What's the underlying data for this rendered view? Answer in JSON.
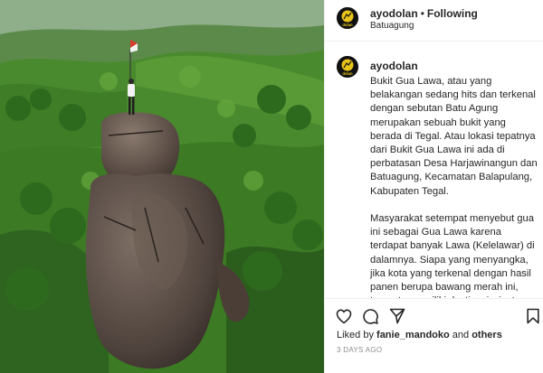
{
  "post": {
    "author": "ayodolan",
    "separator": "•",
    "follow_status": "Following",
    "location": "Batuagung",
    "logo_text": "dolan"
  },
  "caption": {
    "username": "ayodolan",
    "text": "Bukit Gua Lawa, atau yang belakangan sedang hits dan terkenal dengan sebutan Batu Agung merupakan sebuah bukit yang berada di Tegal. Atau lokasi tepatnya dari Bukit Gua Lawa ini ada di perbatasan Desa Harjawinangun dan Batuagung, Kecamatan Balapulang, Kabupaten Tegal.\n\nMasyarakat setempat menyebut gua ini sebagai Gua Lawa karena terdapat banyak Lawa (Kelelawar) di dalamnya. Siapa yang menyangka, jika kota yang terkenal dengan hasil panen berupa bawang merah ini, ternyata memiliki destinasi wisata yang mampu menghilangkan rasa penat yang begitu ampuh. Jadi"
  },
  "actions": {
    "like_icon": "heart-icon",
    "comment_icon": "comment-icon",
    "share_icon": "paper-plane-icon",
    "save_icon": "bookmark-icon"
  },
  "likes": {
    "prefix": "Liked by ",
    "user": "fanie_mandoko",
    "middle": " and ",
    "others": "others"
  },
  "timestamp": "3 DAYS AGO"
}
